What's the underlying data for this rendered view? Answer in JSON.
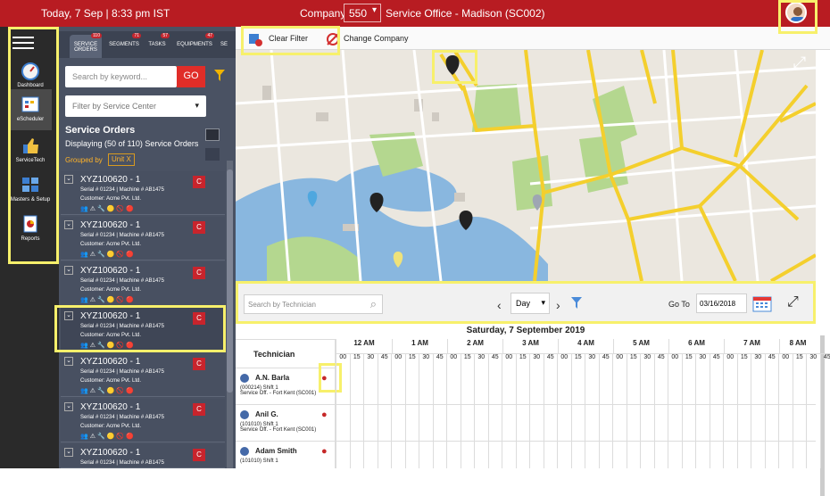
{
  "topbar": {
    "date_time": "Today, 7 Sep  |  8:33 pm IST",
    "company_label": "Company",
    "company_value": "550",
    "office": "Service Office - Madison (SC002)"
  },
  "nav": {
    "items": [
      {
        "label": "Dashboard",
        "icon": "gauge-icon"
      },
      {
        "label": "eScheduler",
        "icon": "calendar-grid-icon"
      },
      {
        "label": "ServiceTech",
        "icon": "thumbs-up-icon"
      },
      {
        "label": "Masters & Setup",
        "icon": "grid-settings-icon"
      },
      {
        "label": "Reports",
        "icon": "report-icon"
      }
    ]
  },
  "panel": {
    "tabs": [
      {
        "label": "SERVICE ORDERS",
        "badge": "110"
      },
      {
        "label": "SEGMENTS",
        "badge": "71"
      },
      {
        "label": "TASKS",
        "badge": "57"
      },
      {
        "label": "EQUIPMENTS",
        "badge": "47"
      },
      {
        "label": "SE",
        "badge": ""
      }
    ],
    "search_placeholder": "Search by keyword...",
    "go_label": "GO",
    "service_center_placeholder": "Filter by Service Center",
    "title": "Service Orders",
    "count_text": "Displaying (50 of 110) Service Orders",
    "grouped_label": "Grouped by",
    "grouped_chip": "Unit  X",
    "orders": [
      {
        "id": "XYZ100620 - 1",
        "meta": "Serial # 01234   |   Machine # AB1475",
        "customer": "Customer: Acme Pvt. Ltd.",
        "action": "C"
      },
      {
        "id": "XYZ100620 - 1",
        "meta": "Serial # 01234   |   Machine # AB1475",
        "customer": "Customer: Acme Pvt. Ltd.",
        "action": "C"
      },
      {
        "id": "XYZ100620 - 1",
        "meta": "Serial # 01234   |   Machine # AB1475",
        "customer": "Customer: Acme Pvt. Ltd.",
        "action": "C"
      },
      {
        "id": "XYZ100620 - 1",
        "meta": "Serial # 01234   |   Machine # AB1475",
        "customer": "Customer: Acme Pvt. Ltd.",
        "action": "C"
      },
      {
        "id": "XYZ100620 - 1",
        "meta": "Serial # 01234   |   Machine # AB1475",
        "customer": "Customer: Acme Pvt. Ltd.",
        "action": "C"
      },
      {
        "id": "XYZ100620 - 1",
        "meta": "Serial # 01234   |   Machine # AB1475",
        "customer": "Customer: Acme Pvt. Ltd.",
        "action": "C"
      },
      {
        "id": "XYZ100620 - 1",
        "meta": "Serial # 01234   |   Machine # AB1475",
        "customer": "",
        "action": "C"
      }
    ]
  },
  "toolbar": {
    "clear_filter": "Clear Filter",
    "change_company": "Change Company"
  },
  "schedule": {
    "search_placeholder": "Search by Technician",
    "view": "Day",
    "goto_label": "Go To",
    "goto_date": "03/16/2018",
    "date_heading": "Saturday, 7 September 2019",
    "tech_header": "Technician",
    "hours": [
      "12 AM",
      "1 AM",
      "2 AM",
      "3 AM",
      "4 AM",
      "5 AM",
      "6 AM",
      "7 AM",
      "8 AM"
    ],
    "minutes": [
      "00",
      "15",
      "30",
      "45"
    ],
    "technicians": [
      {
        "name": "A.N. Barla",
        "line1": "(000214) Shift 1",
        "line2": "Service Off. - Fort Kent (SC001)"
      },
      {
        "name": "Anil G.",
        "line1": "(101010) Shift 1",
        "line2": "Service Off. - Fort Kent (SC001)"
      },
      {
        "name": "Adam Smith",
        "line1": "(101010) Shift 1",
        "line2": ""
      }
    ]
  },
  "colors": {
    "brand": "#b81c22",
    "highlight": "#f7f06b",
    "road": "#f4cf2d",
    "water": "#89b7df",
    "park": "#b4d78f"
  }
}
